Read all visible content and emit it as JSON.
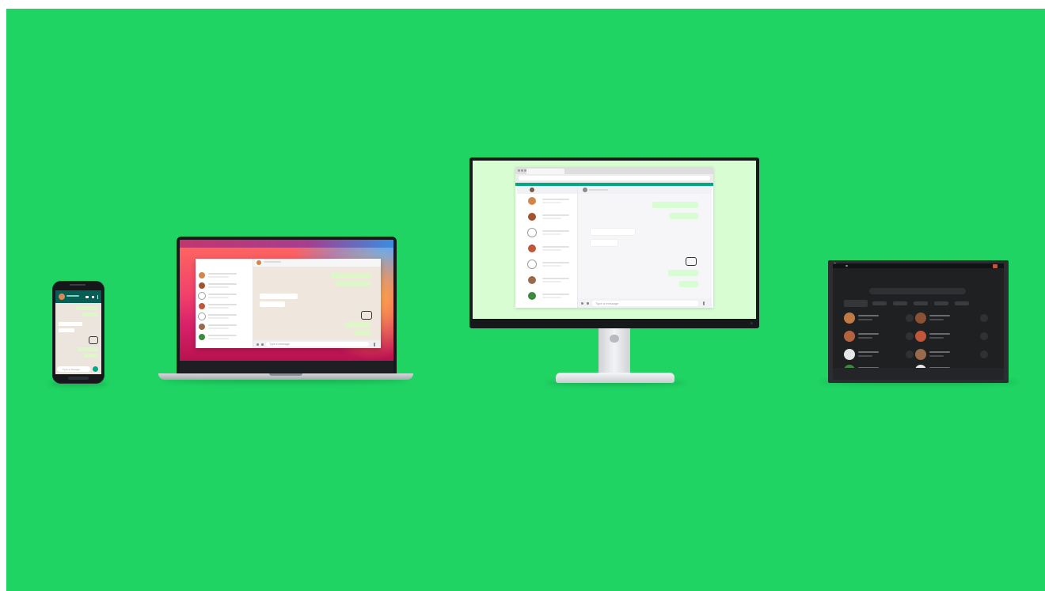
{
  "scene": {
    "background_color": "#1fd463",
    "devices": [
      "phone",
      "laptop",
      "desktop-monitor",
      "smart-display"
    ]
  },
  "phone": {
    "compose_placeholder": "Type a message"
  },
  "laptop": {
    "compose_placeholder": "Type a message"
  },
  "monitor": {
    "compose_placeholder": "Type a message"
  },
  "colors": {
    "accent": "#00a884",
    "header_dark": "#075e54",
    "bubble_out": "#dcf8c6",
    "chat_bg": "#efe7de"
  }
}
